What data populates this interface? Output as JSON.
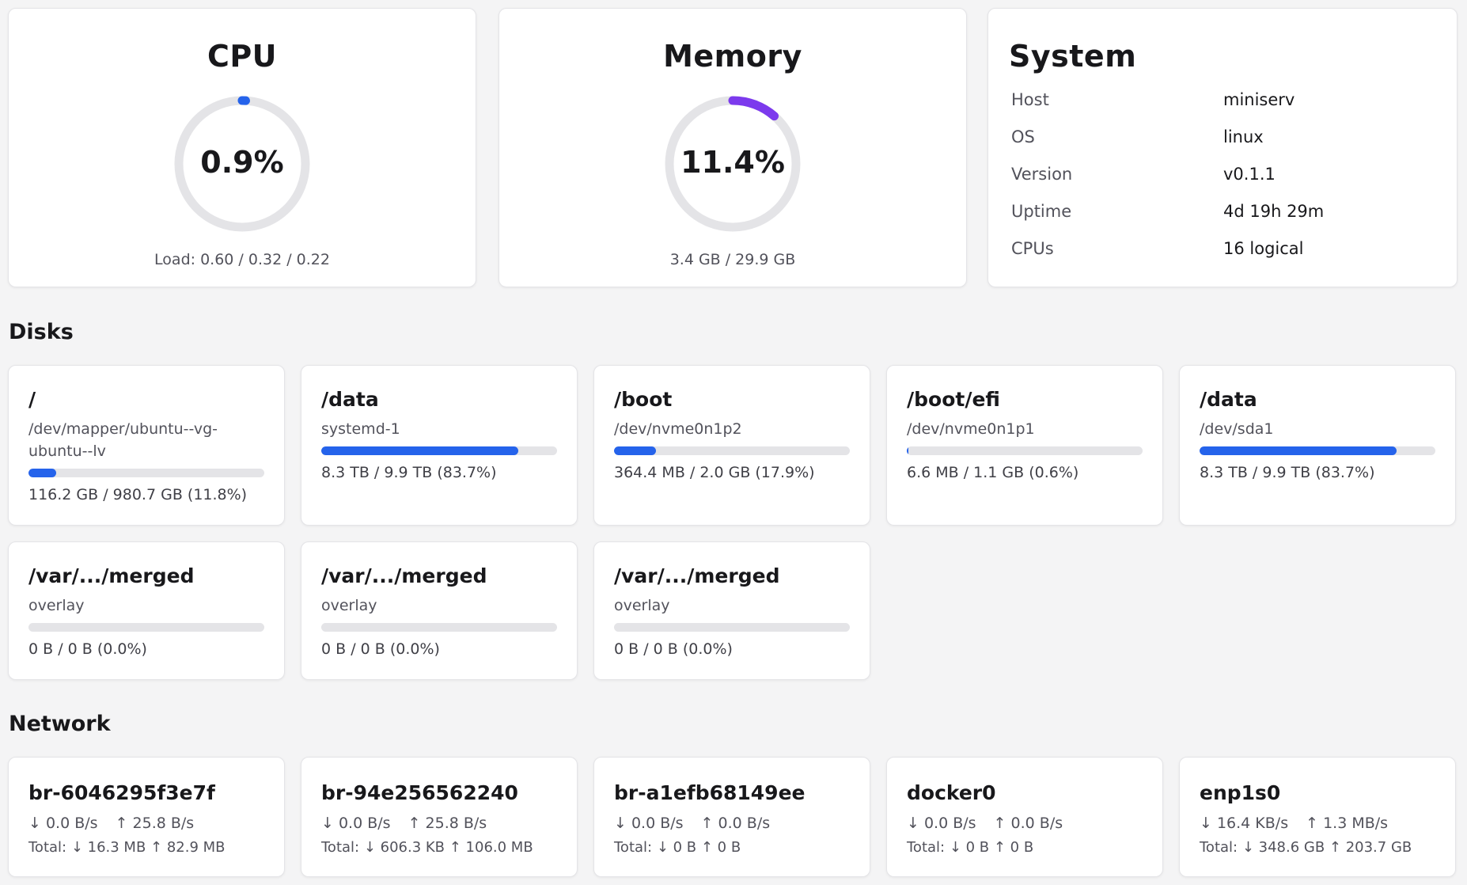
{
  "cpu": {
    "title": "CPU",
    "value": "0.9%",
    "percent": 0.9,
    "load": "Load: 0.60 / 0.32 / 0.22",
    "color": "#2563eb"
  },
  "memory": {
    "title": "Memory",
    "value": "11.4%",
    "percent": 11.4,
    "usage": "3.4 GB / 29.9 GB",
    "color": "#7c3aed"
  },
  "system": {
    "title": "System",
    "rows": [
      {
        "label": "Host",
        "value": "miniserv"
      },
      {
        "label": "OS",
        "value": "linux"
      },
      {
        "label": "Version",
        "value": "v0.1.1"
      },
      {
        "label": "Uptime",
        "value": "4d 19h 29m"
      },
      {
        "label": "CPUs",
        "value": "16 logical"
      }
    ]
  },
  "disks": {
    "title": "Disks",
    "items": [
      {
        "mount": "/",
        "device": "/dev/mapper/ubuntu--vg-ubuntu--lv",
        "usage": "116.2 GB / 980.7 GB (11.8%)",
        "percent": 11.8
      },
      {
        "mount": "/data",
        "device": "systemd-1",
        "usage": "8.3 TB / 9.9 TB (83.7%)",
        "percent": 83.7
      },
      {
        "mount": "/boot",
        "device": "/dev/nvme0n1p2",
        "usage": "364.4 MB / 2.0 GB (17.9%)",
        "percent": 17.9
      },
      {
        "mount": "/boot/efi",
        "device": "/dev/nvme0n1p1",
        "usage": "6.6 MB / 1.1 GB (0.6%)",
        "percent": 0.6
      },
      {
        "mount": "/data",
        "device": "/dev/sda1",
        "usage": "8.3 TB / 9.9 TB (83.7%)",
        "percent": 83.7
      },
      {
        "mount": "/var/.../merged",
        "device": "overlay",
        "usage": "0 B / 0 B (0.0%)",
        "percent": 0
      },
      {
        "mount": "/var/.../merged",
        "device": "overlay",
        "usage": "0 B / 0 B (0.0%)",
        "percent": 0
      },
      {
        "mount": "/var/.../merged",
        "device": "overlay",
        "usage": "0 B / 0 B (0.0%)",
        "percent": 0
      }
    ]
  },
  "network": {
    "title": "Network",
    "items": [
      {
        "name": "br-6046295f3e7f",
        "down": "↓ 0.0 B/s",
        "up": "↑ 25.8 B/s",
        "total": "Total: ↓ 16.3 MB ↑ 82.9 MB"
      },
      {
        "name": "br-94e256562240",
        "down": "↓ 0.0 B/s",
        "up": "↑ 25.8 B/s",
        "total": "Total: ↓ 606.3 KB ↑ 106.0 MB"
      },
      {
        "name": "br-a1efb68149ee",
        "down": "↓ 0.0 B/s",
        "up": "↑ 0.0 B/s",
        "total": "Total: ↓ 0 B ↑ 0 B"
      },
      {
        "name": "docker0",
        "down": "↓ 0.0 B/s",
        "up": "↑ 0.0 B/s",
        "total": "Total: ↓ 0 B ↑ 0 B"
      },
      {
        "name": "enp1s0",
        "down": "↓ 16.4 KB/s",
        "up": "↑ 1.3 MB/s",
        "total": "Total: ↓ 348.6 GB ↑ 203.7 GB"
      }
    ]
  },
  "colors": {
    "bar_fill": "#2563eb",
    "track": "#e4e4e7"
  }
}
